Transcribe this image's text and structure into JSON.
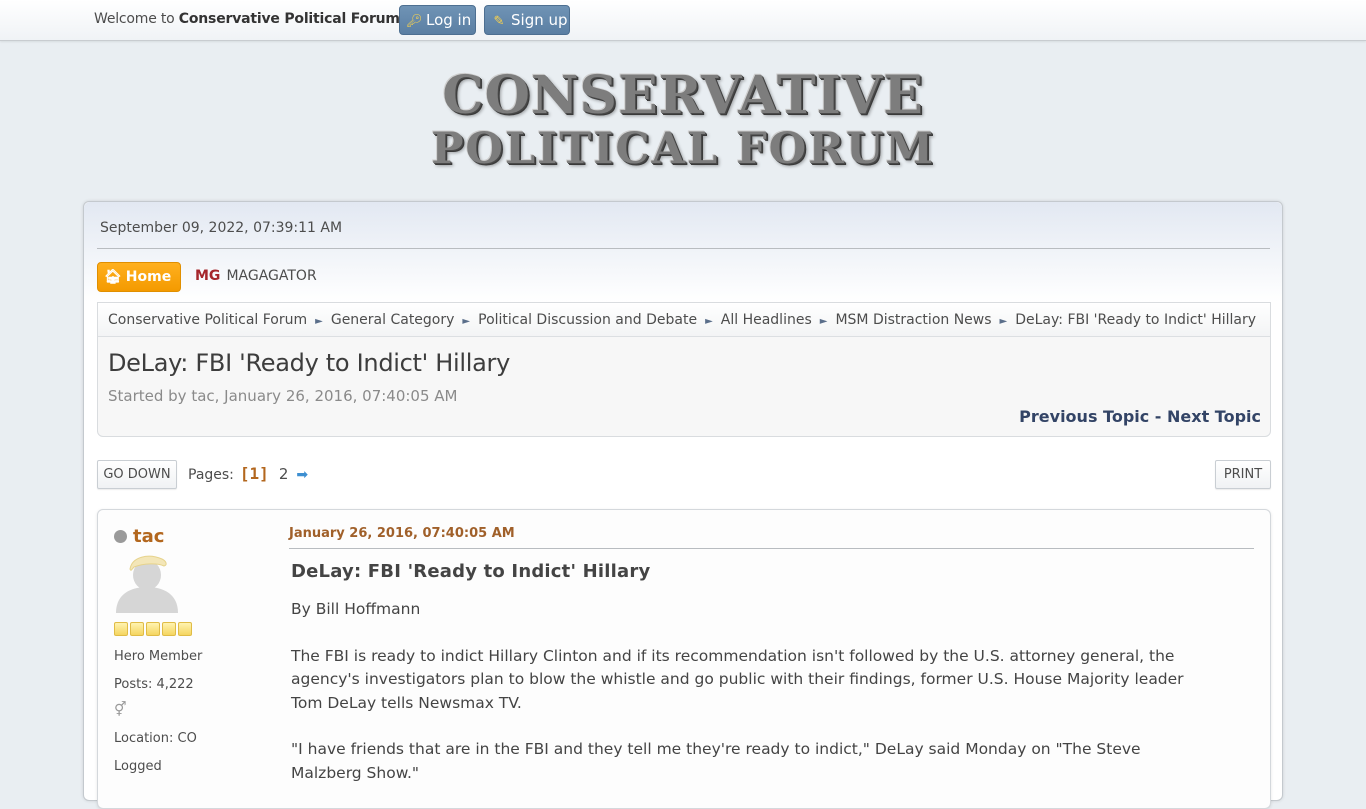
{
  "top_bar": {
    "welcome_prefix": "Welcome to ",
    "site_name": "Conservative Political Forum",
    "welcome_suffix": ".",
    "login_label": "Log in",
    "signup_label": "Sign up"
  },
  "logo": {
    "line1": "CONSERVATIVE",
    "line2": "POLITICAL FORUM"
  },
  "header": {
    "datetime": "September 09, 2022, 07:39:11 AM",
    "home_label": "Home",
    "mg_badge": "MG",
    "magagator_label": "MAGAGATOR"
  },
  "breadcrumb": [
    "Conservative Political Forum",
    "General Category",
    "Political Discussion and Debate",
    "All Headlines",
    "MSM Distraction News",
    "DeLay: FBI 'Ready to Indict' Hillary"
  ],
  "breadcrumb_separator": "►",
  "topic": {
    "title": "DeLay: FBI 'Ready to Indict' Hillary",
    "started_by": "Started by tac, January 26, 2016, 07:40:05 AM",
    "previous_label": "Previous Topic",
    "next_separator": " - ",
    "next_label": "Next Topic"
  },
  "pagination": {
    "go_down_label": "GO DOWN",
    "pages_label": "Pages:",
    "current_page": "[1]",
    "other_pages": [
      "2"
    ],
    "next_arrow": "➡",
    "print_label": "PRINT"
  },
  "post": {
    "author": "tac",
    "status": "offline",
    "rank": "Hero Member",
    "stars": 5,
    "posts": "Posts: 4,222",
    "gender_icon": "male-icon",
    "location": "Location: CO",
    "logged": "Logged",
    "date": "January 26, 2016, 07:40:05 AM",
    "subject": "DeLay: FBI 'Ready to Indict' Hillary",
    "byline": "By Bill Hoffmann",
    "paragraphs": [
      "The FBI is ready to indict Hillary Clinton and if its recommendation isn't followed by the U.S. attorney general, the agency's investigators plan to blow the whistle and go public with their findings, former U.S. House Majority leader Tom DeLay tells Newsmax TV.",
      "\"I have friends that are in the FBI and they tell me they're ready to indict,\" DeLay said Monday on \"The Steve Malzberg Show.\""
    ]
  },
  "colors": {
    "page_bg": "#e9eef2",
    "login_btn": "#5b7fa3",
    "home_btn": "#f49a00",
    "mg_red": "#a5262c",
    "author_orange": "#b3671e",
    "nav_link": "#334466"
  }
}
